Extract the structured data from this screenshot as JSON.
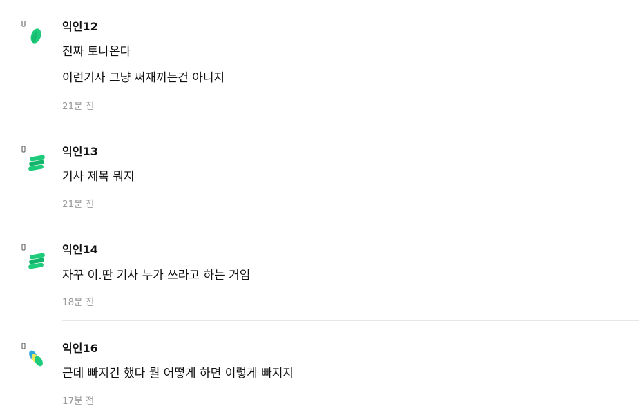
{
  "comments": [
    {
      "author": "익인12",
      "lines": [
        "진짜 토나온다",
        "이런기사 그냥 써재끼는건 아니지"
      ],
      "time": "21분 전",
      "avatar_icon": "green-leaf-icon"
    },
    {
      "author": "익인13",
      "lines": [
        "기사 제목 뭐지"
      ],
      "time": "21분 전",
      "avatar_icon": "green-stack-icon"
    },
    {
      "author": "익인14",
      "lines": [
        "자꾸 이.딴 기사 누가 쓰라고 하는 거임"
      ],
      "time": "18분 전",
      "avatar_icon": "green-stack-icon"
    },
    {
      "author": "익인16",
      "lines": [
        "근데 빠지긴 했다 뭘 어떻게 하면 이렇게 빠지지"
      ],
      "time": "17분 전",
      "avatar_icon": "green-blue-yellow-pill-icon"
    }
  ],
  "colors": {
    "author": "#111111",
    "text": "#111111",
    "time": "#9a9a9a",
    "divider": "#e6e6e6",
    "avatar_green": "#1ecb7b",
    "avatar_dark_green": "#12b36a",
    "avatar_blue": "#2aa7e0",
    "avatar_yellow": "#e9e85a"
  }
}
